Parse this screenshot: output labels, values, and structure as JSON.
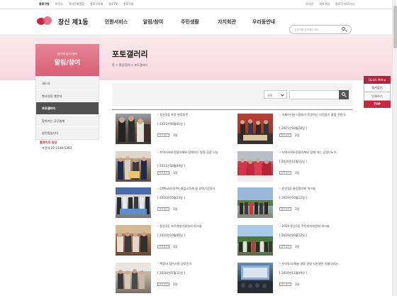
{
  "topbar": {
    "left": [
      "종로구청",
      "보건소",
      "역사문화관광",
      "종로구의회",
      "종로TV",
      "종로사랑"
    ],
    "right": [
      "로그인",
      "회원가입",
      "종로구 바로가기"
    ]
  },
  "header": {
    "logo_text": "창신 제1동",
    "menu": [
      "민원서비스",
      "알림/참여",
      "주민생활",
      "자치회관",
      "우리동안내"
    ],
    "search_placeholder": "검색어를 입력해주세요"
  },
  "sidebar": {
    "sub": "창신제1동주민센터",
    "title": "알림/참여",
    "items": [
      "새소식",
      "행사일정 캘린더",
      "포토갤러리",
      "찾아가는 공무원제",
      "참된말씀시다"
    ],
    "active_index": 2,
    "contact_title": "홈페이지 담당",
    "contact": "· 이민아 02-2148-5393"
  },
  "page": {
    "title": "포토갤러리",
    "breadcrumb": "홈 > 알림/참여 > 포토갤러리"
  },
  "filter": {
    "select_value": "선택"
  },
  "gallery": [
    {
      "title": "– 창신1동 복장 현장방문",
      "date": "[ 2021년08월01일 ]",
      "new": "사진 보기",
      "count": "3장"
    },
    {
      "title": "– 국제라이온스협회가 후원하는 이웃돕기 물품 전달식",
      "date": "[ 2021년10월28일 ]",
      "new": "사진 보기",
      "count": "2장"
    },
    {
      "title": "– 지역사회보장협의체와 함께하는 명절 김장 나눔",
      "date": "[ 2021년08월09일 ]",
      "new": "사진 보기",
      "count": "3장"
    },
    {
      "title": "– 지역사회보장협의체와 함께 하는 김장나누기",
      "date": "[ 2020년11월11일 ]",
      "new": "사진 보기",
      "count": "3장"
    },
    {
      "title": "– CMS코리아(주) 쌀값소독제 및 방역기전달식",
      "date": "[ 2020년10월23일 ]",
      "new": "사진 보기",
      "count": "3장"
    },
    {
      "title": "– 창신1동 통장협의회 워크숍",
      "date": "[ 2019년10월12일 ]",
      "new": "사진 보기",
      "count": "3장"
    },
    {
      "title": "– 창신1동 바르게살기위원회 워크숍",
      "date": "[ 2019년10월06일 ]",
      "new": "사진 보기",
      "count": "3장"
    },
    {
      "title": "– 2019 창신1동 주민자치위원회 워크숍",
      "date": "[ 2019년09월22일 ]",
      "new": "사진 보기",
      "count": "3장"
    },
    {
      "title": "– 복합이 장수기원 경로잔치",
      "date": "[ 2018년07월11일 ]",
      "new": "사진 보기",
      "count": "3장"
    },
    {
      "title": "– 우리동네 예술 영화 상영 <안생은 아름다워>",
      "date": "[ 2016년11월09일 ]",
      "new": "사진 보기",
      "count": "3장"
    }
  ],
  "quick": {
    "head": "Quick Menu",
    "items": [
      "즐겨찾기",
      "인쇄하기"
    ],
    "top": "TOP"
  }
}
